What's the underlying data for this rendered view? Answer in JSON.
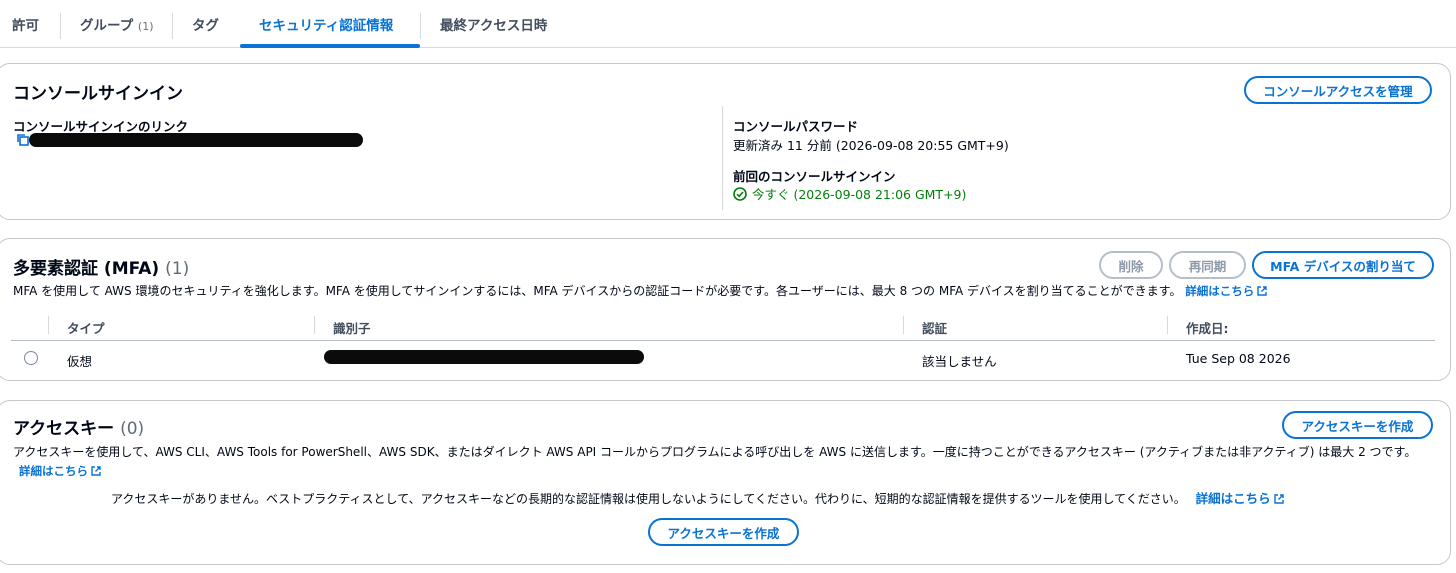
{
  "tabs": [
    {
      "label": "許可"
    },
    {
      "label": "グループ",
      "count": "(1)"
    },
    {
      "label": "タグ"
    },
    {
      "label": "セキュリティ認証情報",
      "active": true
    },
    {
      "label": "最終アクセス日時"
    }
  ],
  "console_signin": {
    "title": "コンソールサインイン",
    "manage_button": "コンソールアクセスを管理",
    "link_label": "コンソールサインインのリンク",
    "password_label": "コンソールパスワード",
    "password_value": "更新済み 11 分前 (2026-09-08 20:55 GMT+9)",
    "last_signin_label": "前回のコンソールサインイン",
    "last_signin_value": "今すぐ (2026-09-08 21:06 GMT+9)",
    "success_color": "#037f0c"
  },
  "mfa": {
    "title": "多要素認証 (MFA)",
    "count": "(1)",
    "delete_button": "削除",
    "resync_button": "再同期",
    "assign_button": "MFA デバイスの割り当て",
    "description": "MFA を使用して AWS 環境のセキュリティを強化します。MFA を使用してサインインするには、MFA デバイスからの認証コードが必要です。各ユーザーには、最大 8 つの MFA デバイスを割り当てることができます。",
    "learn_more": "詳細はこちら",
    "columns": [
      "タイプ",
      "識別子",
      "認証",
      "作成日:"
    ],
    "rows": [
      {
        "type": "仮想",
        "auth": "該当しません",
        "created": "Tue Sep 08 2026"
      }
    ]
  },
  "access_keys": {
    "title": "アクセスキー",
    "count": "(0)",
    "create_button": "アクセスキーを作成",
    "description": "アクセスキーを使用して、AWS CLI、AWS Tools for PowerShell、AWS SDK、またはダイレクト AWS API コールからプログラムによる呼び出しを AWS に送信します。一度に持つことができるアクセスキー (アクティブまたは非アクティブ) は最大 2 つです。",
    "learn_more": "詳細はこちら",
    "empty_message": "アクセスキーがありません。ベストプラクティスとして、アクセスキーなどの長期的な認証情報は使用しないようにしてください。代わりに、短期的な認証情報を提供するツールを使用してください。",
    "empty_learn_more": "詳細はこちら",
    "empty_create_button": "アクセスキーを作成"
  },
  "colors": {
    "accent": "#0972d3",
    "border": "#c6c6cd"
  }
}
